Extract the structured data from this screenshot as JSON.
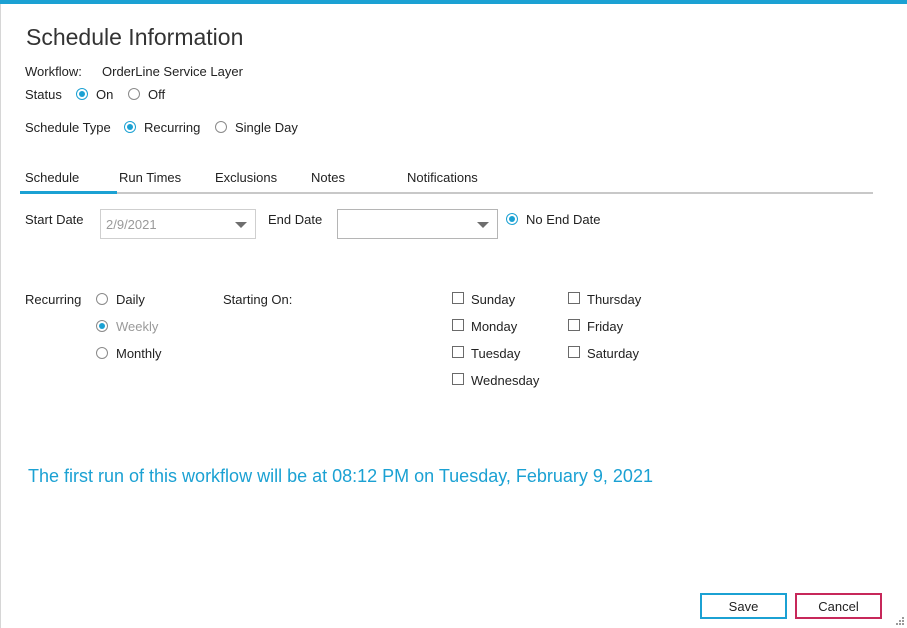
{
  "title": "Schedule Information",
  "workflow": {
    "label": "Workflow:",
    "value": "OrderLine Service Layer"
  },
  "status": {
    "label": "Status",
    "options": [
      "On",
      "Off"
    ],
    "selected": "On"
  },
  "schedule_type": {
    "label": "Schedule Type",
    "options": [
      "Recurring",
      "Single Day"
    ],
    "selected": "Recurring"
  },
  "tabs": [
    {
      "label": "Schedule",
      "active": true
    },
    {
      "label": "Run Times",
      "active": false
    },
    {
      "label": "Exclusions",
      "active": false
    },
    {
      "label": "Notes",
      "active": false
    },
    {
      "label": "Notifications",
      "active": false
    }
  ],
  "start_date": {
    "label": "Start Date",
    "value": "2/9/2021"
  },
  "end_date": {
    "label": "End Date",
    "value": ""
  },
  "no_end_date": {
    "label": "No End Date",
    "checked": true
  },
  "recurring": {
    "label": "Recurring",
    "options": [
      "Daily",
      "Weekly",
      "Monthly"
    ],
    "selected": "Weekly"
  },
  "starting_on": {
    "label": "Starting On:"
  },
  "days": {
    "sunday": "Sunday",
    "monday": "Monday",
    "tuesday": "Tuesday",
    "wednesday": "Wednesday",
    "thursday": "Thursday",
    "friday": "Friday",
    "saturday": "Saturday"
  },
  "info_message": "The first run of this workflow will be at 08:12 PM on Tuesday, February 9, 2021",
  "buttons": {
    "save": "Save",
    "cancel": "Cancel"
  },
  "colors": {
    "accent": "#1ba1d3",
    "cancel_border": "#c7285a"
  }
}
